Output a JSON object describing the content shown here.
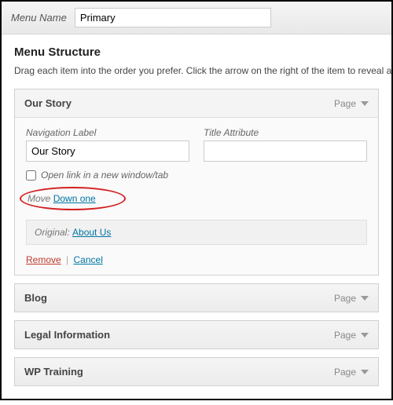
{
  "header": {
    "menu_name_label": "Menu Name",
    "menu_name_value": "Primary"
  },
  "section": {
    "title": "Menu Structure",
    "description": "Drag each item into the order you prefer. Click the arrow on the right of the item to reveal a"
  },
  "expanded_item": {
    "title": "Our Story",
    "type": "Page",
    "nav_label_label": "Navigation Label",
    "nav_label_value": "Our Story",
    "title_attr_label": "Title Attribute",
    "title_attr_value": "",
    "open_new_tab_label": "Open link in a new window/tab",
    "move_label": "Move",
    "move_down_one": "Down one",
    "original_label": "Original:",
    "original_link": "About Us",
    "remove_label": "Remove",
    "cancel_label": "Cancel"
  },
  "collapsed_items": [
    {
      "title": "Blog",
      "type": "Page"
    },
    {
      "title": "Legal Information",
      "type": "Page"
    },
    {
      "title": "WP Training",
      "type": "Page"
    }
  ]
}
